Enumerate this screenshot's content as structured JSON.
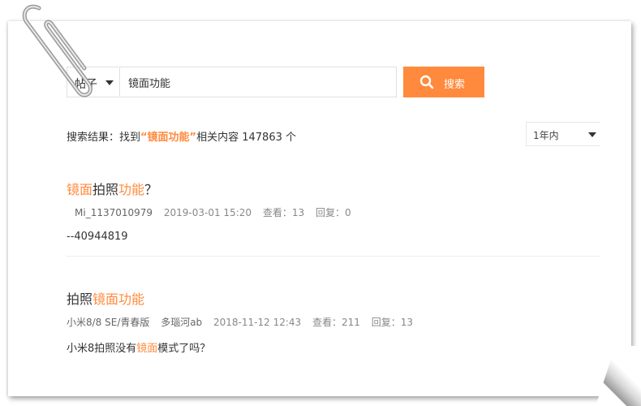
{
  "search": {
    "type_label": "帖子",
    "query": "镜面功能",
    "button_label": "搜索"
  },
  "summary": {
    "prefix": "搜索结果：找到",
    "keyword": "“镜面功能”",
    "suffix": "相关内容 147863 个"
  },
  "time_filter": {
    "selected": "1年内"
  },
  "results": [
    {
      "title_parts": [
        "镜面",
        "拍照",
        "功能",
        "？"
      ],
      "author": "Mi_1137010979",
      "date": "2019-03-01 15:20",
      "views": "查看：13",
      "replies": "回复：0",
      "excerpt": "--40944819"
    },
    {
      "title_parts": [
        "拍照",
        "镜面功能"
      ],
      "forum": "小米8/8 SE/青春版",
      "author": "多瑙河ab",
      "date": "2018-11-12 12:43",
      "views": "查看：211",
      "replies": "回复：13",
      "excerpt_parts": [
        "小米8拍照没有",
        "镜面",
        "模式了吗？"
      ]
    }
  ],
  "colors": {
    "accent": "#ff8a3d",
    "text": "#333333",
    "muted": "#888888"
  },
  "icons": {
    "search_button": "search-icon",
    "decoration": "paperclip-icon"
  }
}
